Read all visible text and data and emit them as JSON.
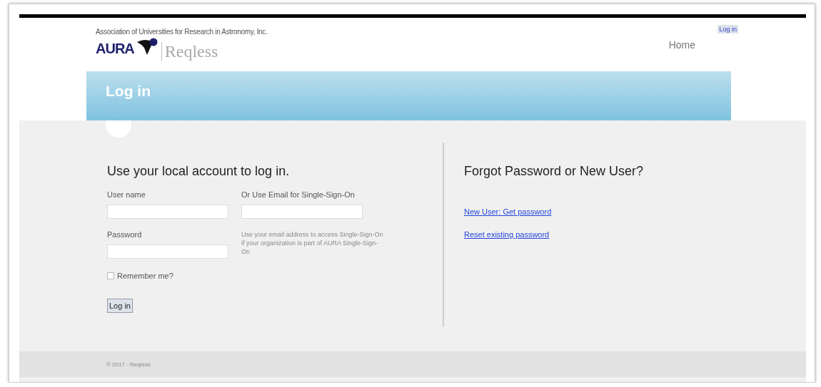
{
  "header": {
    "organization": "Association of Universities for Research in Astronomy, Inc.",
    "logo_text": "AURA",
    "app_name": "Reqless",
    "login_link": "Log in",
    "nav": [
      "Home"
    ]
  },
  "banner": {
    "title": "Log in"
  },
  "login": {
    "heading": "Use your local account to log in.",
    "username": {
      "label": "User name"
    },
    "password": {
      "label": "Password"
    },
    "remember": {
      "label": "Remember me?",
      "checked": false
    },
    "submit": "Log in",
    "sso": {
      "label": "Or Use Email for Single-Sign-On",
      "hint": "Use your email address to access Single-Sign-On if your organization is part of AURA Single-Sign-On"
    }
  },
  "help": {
    "heading": "Forgot Password or New User?",
    "links": [
      "New User: Get password",
      "Reset existing password"
    ]
  },
  "footer": "© 2017 - Reqless"
}
